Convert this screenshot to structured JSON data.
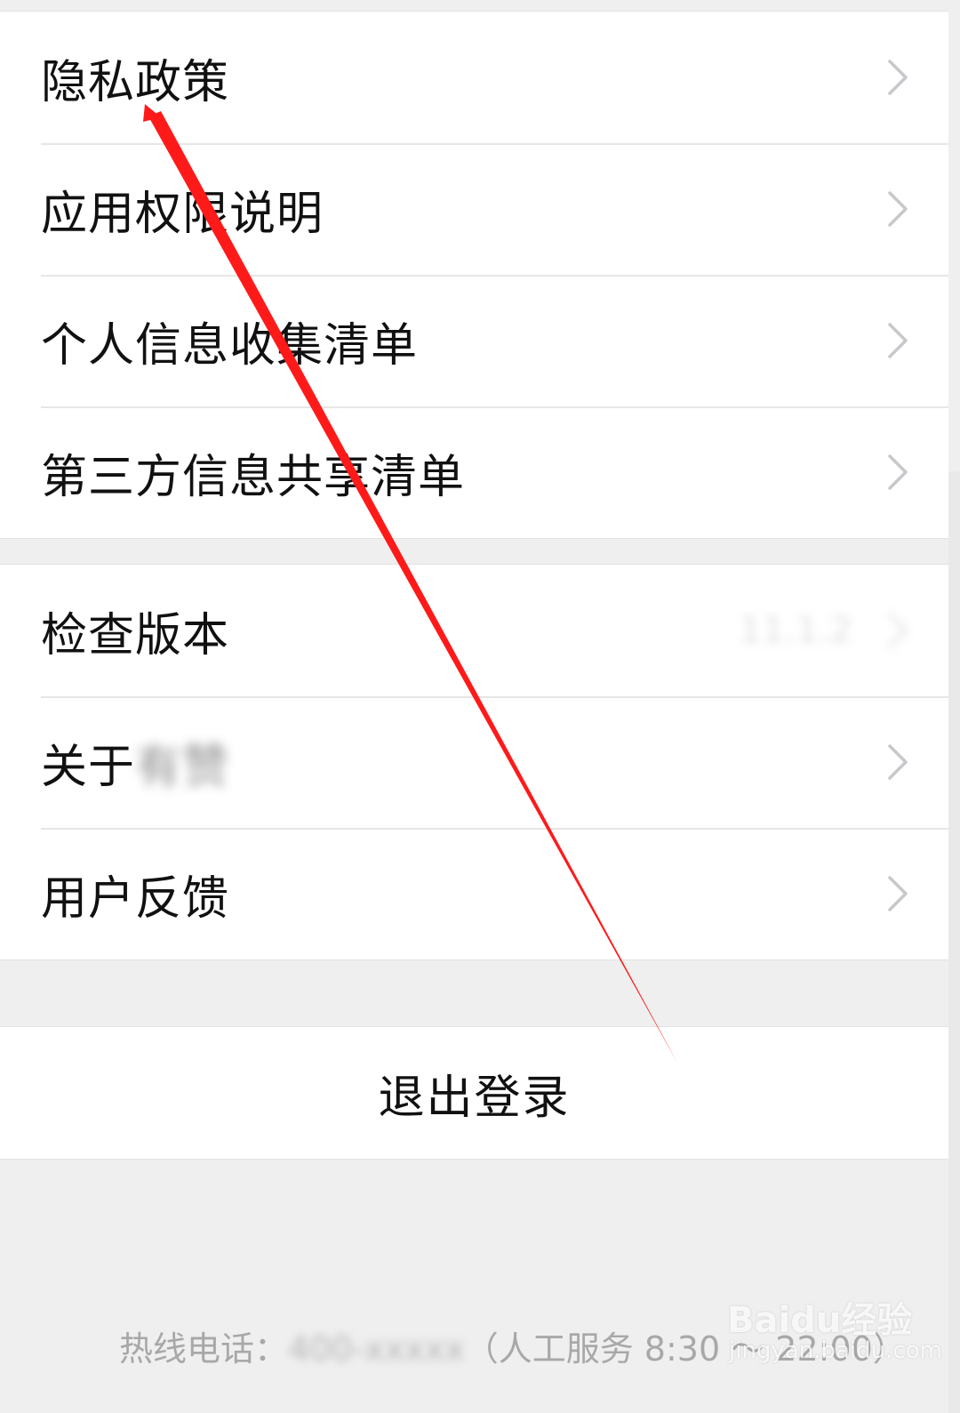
{
  "settings": {
    "group1": [
      {
        "label": "隐私政策"
      },
      {
        "label": "应用权限说明"
      },
      {
        "label": "个人信息收集清单"
      },
      {
        "label": "第三方信息共享清单"
      }
    ],
    "group2": {
      "check_version": {
        "label": "检查版本",
        "value": "11.1.2"
      },
      "about": {
        "label": "关于",
        "app_name": "有赞"
      },
      "feedback": {
        "label": "用户反馈"
      }
    },
    "logout_label": "退出登录"
  },
  "footer": {
    "hotline_label": "热线电话：",
    "hotline_number": "400-xxxxx",
    "service_hours": "（人工服务 8:30 ～ 22:00）"
  },
  "watermark": {
    "brand": "Baidu经验",
    "site": "jingyan.baidu.com"
  },
  "colors": {
    "background": "#efefef",
    "card": "#ffffff",
    "annotation_arrow": "#ff1a1a",
    "hint_text": "#a8a8a8"
  },
  "icons": {
    "row_disclosure": "chevron-right-icon"
  }
}
